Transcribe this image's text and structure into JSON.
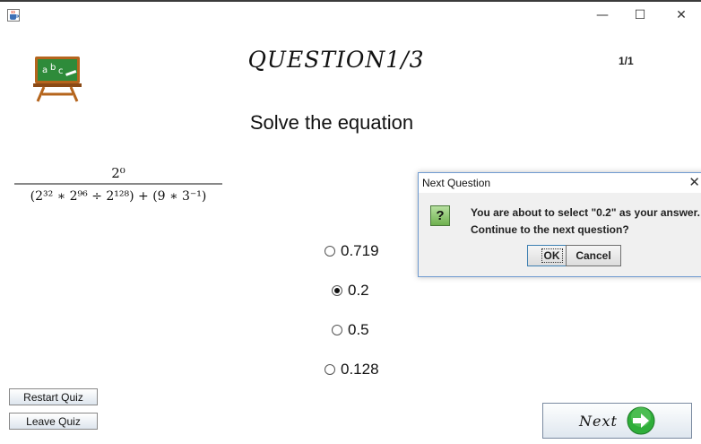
{
  "window": {
    "minimize": "—",
    "maximize": "☐",
    "close": "✕"
  },
  "header": {
    "title": "QUESTION1/3",
    "counter": "1/1"
  },
  "question": {
    "prompt": "Solve the equation",
    "equation": {
      "numerator": "2⁰",
      "denominator": "(2³² ∗ 2⁹⁶ ÷ 2¹²⁸) + (9 ∗ 3⁻¹)"
    },
    "options": [
      {
        "label": "0.719",
        "selected": false
      },
      {
        "label": "0.2",
        "selected": true
      },
      {
        "label": "0.5",
        "selected": false
      },
      {
        "label": "0.128",
        "selected": false
      }
    ]
  },
  "buttons": {
    "restart": "Restart Quiz",
    "leave": "Leave Quiz",
    "next": "Next"
  },
  "dialog": {
    "title": "Next Question",
    "close": "✕",
    "icon": "?",
    "message_line1": "You are about to select \"0.2\" as your answer.",
    "message_line2": "Continue to the next question?",
    "ok": "OK",
    "cancel": "Cancel"
  },
  "icons": {
    "app": "java-cup-icon",
    "board": "chalkboard-abc-icon",
    "next_arrow": "green-arrow-icon",
    "question": "question-icon"
  },
  "colors": {
    "board_green": "#2e8b3a",
    "board_wood": "#b5651d",
    "arrow_green": "#2fae3a",
    "dialog_border": "#6f9bd1"
  }
}
